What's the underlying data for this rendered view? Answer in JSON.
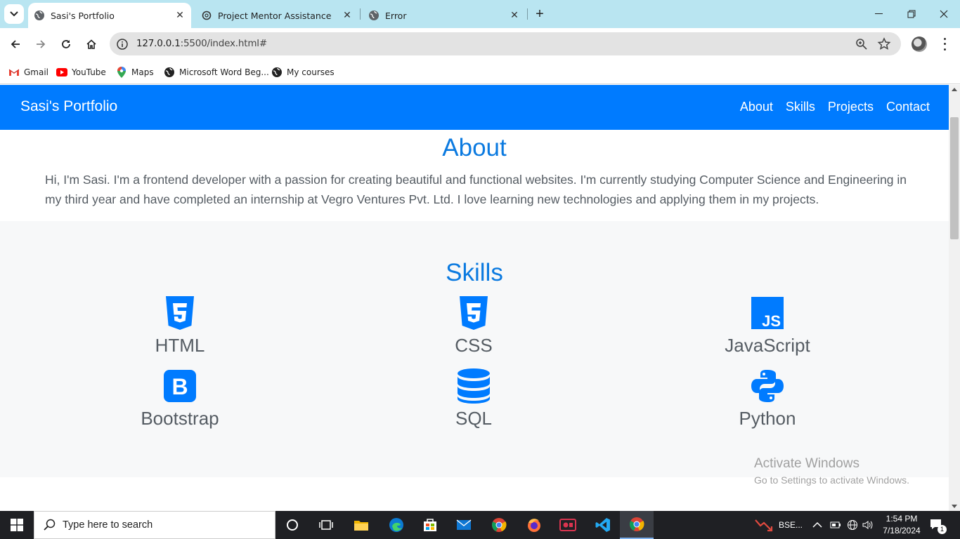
{
  "browser": {
    "tabs": [
      {
        "title": "Sasi's Portfolio",
        "active": true
      },
      {
        "title": "Project Mentor Assistance",
        "active": false
      },
      {
        "title": "Error",
        "active": false
      }
    ],
    "url_host": "127.0.0.1",
    "url_rest": ":5500/index.html#",
    "bookmarks": [
      "Gmail",
      "YouTube",
      "Maps",
      "Microsoft Word Beg...",
      "My courses"
    ]
  },
  "page": {
    "brand": "Sasi's Portfolio",
    "nav": [
      "About",
      "Skills",
      "Projects",
      "Contact"
    ],
    "about": {
      "title": "About",
      "text": "Hi, I'm Sasi. I'm a frontend developer with a passion for creating beautiful and functional websites. I'm currently studying Computer Science and Engineering in my third year and have completed an internship at Vegro Ventures Pvt. Ltd. I love learning new technologies and applying them in my projects."
    },
    "skills": {
      "title": "Skills",
      "items": [
        {
          "label": "HTML",
          "icon": "html5-icon"
        },
        {
          "label": "CSS",
          "icon": "css3-icon"
        },
        {
          "label": "JavaScript",
          "icon": "javascript-icon"
        },
        {
          "label": "Bootstrap",
          "icon": "bootstrap-icon"
        },
        {
          "label": "SQL",
          "icon": "database-icon"
        },
        {
          "label": "Python",
          "icon": "python-icon"
        }
      ]
    },
    "accent_color": "#007bff"
  },
  "watermark": {
    "line1": "Activate Windows",
    "line2": "Go to Settings to activate Windows."
  },
  "taskbar": {
    "search_placeholder": "Type here to search",
    "tray_app": "BSE...",
    "time": "1:54 PM",
    "date": "7/18/2024",
    "notification_count": "1"
  }
}
